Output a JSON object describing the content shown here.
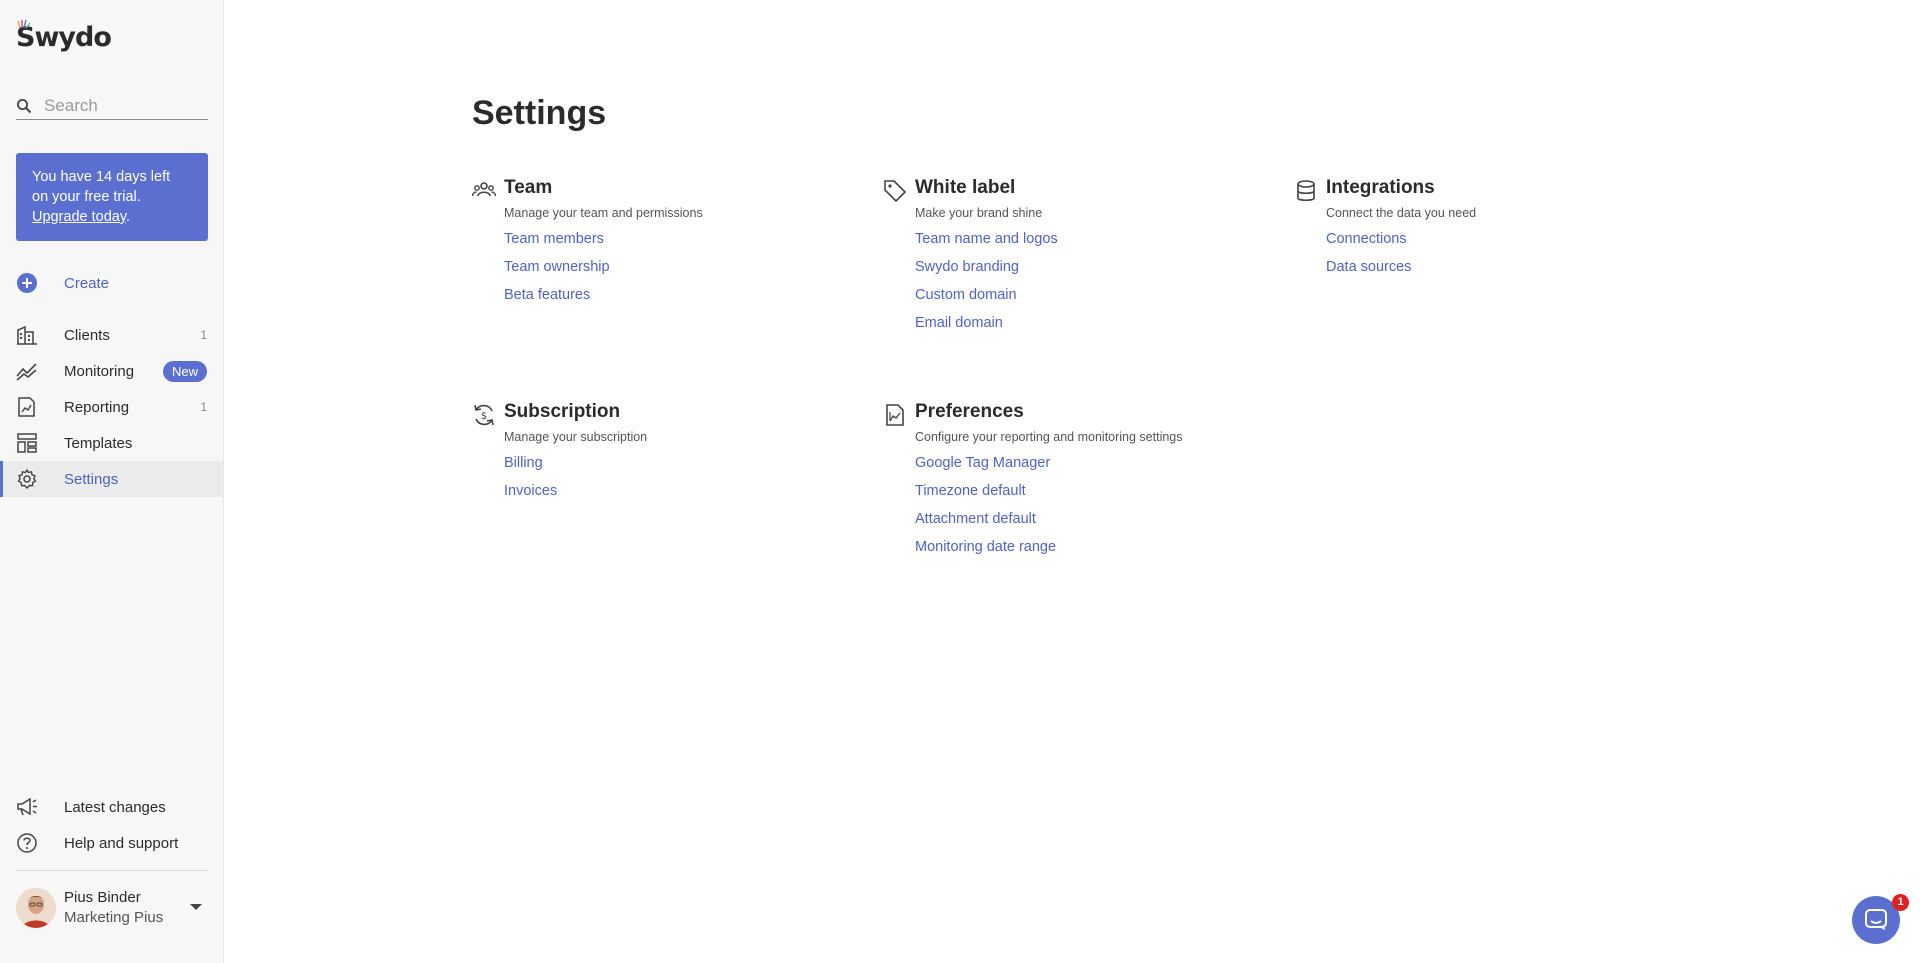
{
  "brand": {
    "name": "Swydo"
  },
  "search": {
    "placeholder": "Search",
    "value": ""
  },
  "trial": {
    "line1": "You have 14 days left",
    "line2": "on your free trial.",
    "link": "Upgrade today",
    "suffix": "."
  },
  "nav": {
    "create": "Create",
    "items": [
      {
        "label": "Clients",
        "count": "1"
      },
      {
        "label": "Monitoring",
        "badge": "New"
      },
      {
        "label": "Reporting",
        "count": "1"
      },
      {
        "label": "Templates"
      },
      {
        "label": "Settings"
      }
    ],
    "bottom": [
      {
        "label": "Latest changes"
      },
      {
        "label": "Help and support"
      }
    ]
  },
  "user": {
    "name": "Pius Binder",
    "org": "Marketing Pius"
  },
  "page": {
    "title": "Settings"
  },
  "sections": [
    {
      "title": "Team",
      "icon": "team-icon",
      "description": "Manage your team and permissions",
      "links": [
        "Team members",
        "Team ownership",
        "Beta features"
      ]
    },
    {
      "title": "White label",
      "icon": "tag-icon",
      "description": "Make your brand shine",
      "links": [
        "Team name and logos",
        "Swydo branding",
        "Custom domain",
        "Email domain"
      ]
    },
    {
      "title": "Integrations",
      "icon": "database-icon",
      "description": "Connect the data you need",
      "links": [
        "Connections",
        "Data sources"
      ]
    },
    {
      "title": "Subscription",
      "icon": "subscription-icon",
      "description": "Manage your subscription",
      "links": [
        "Billing",
        "Invoices"
      ]
    },
    {
      "title": "Preferences",
      "icon": "report-icon",
      "description": "Configure your reporting and monitoring settings",
      "links": [
        "Google Tag Manager",
        "Timezone default",
        "Attachment default",
        "Monitoring date range"
      ]
    }
  ],
  "chat": {
    "badge": "1"
  },
  "colors": {
    "accent": "#5a6fd0",
    "link": "#4f63c7",
    "sidebar_bg": "#f7f7f7",
    "badge_red": "#e0211f"
  }
}
